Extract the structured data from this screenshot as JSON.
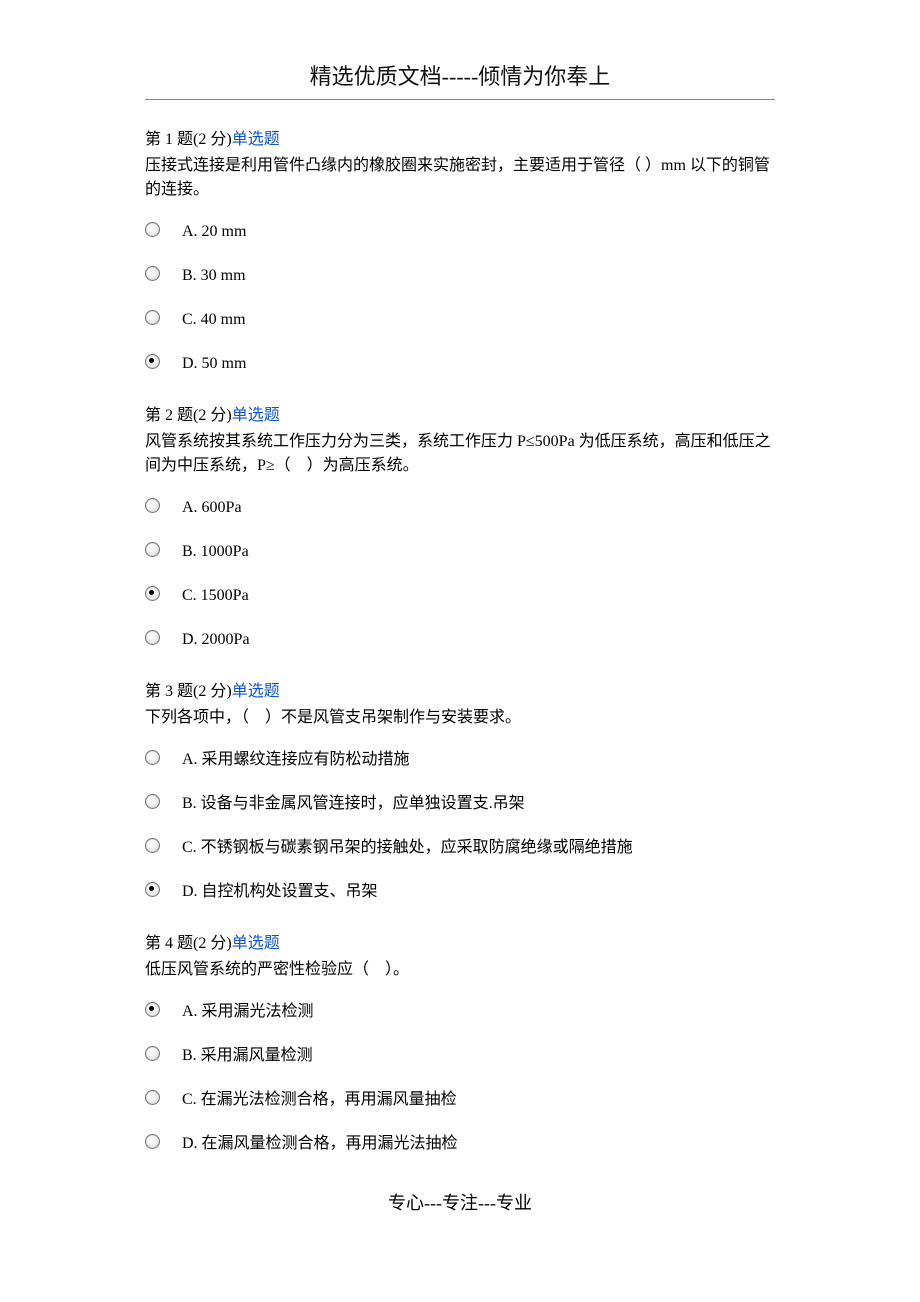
{
  "header": "精选优质文档-----倾情为你奉上",
  "footer": "专心---专注---专业",
  "questions": [
    {
      "number": "第 1 题",
      "points": "(2 分)",
      "type": "单选题",
      "body": "压接式连接是利用管件凸缘内的橡胶圈来实施密封，主要适用于管径（ ）mm 以下的铜管的连接。",
      "options": [
        {
          "label": "A. 20 mm",
          "selected": false
        },
        {
          "label": "B. 30 mm",
          "selected": false
        },
        {
          "label": "C. 40 mm",
          "selected": false
        },
        {
          "label": "D. 50 mm",
          "selected": true
        }
      ]
    },
    {
      "number": "第 2 题",
      "points": "(2 分)",
      "type": "单选题",
      "body": "风管系统按其系统工作压力分为三类，系统工作压力 P≤500Pa 为低压系统，高压和低压之间为中压系统，P≥（　）为高压系统。",
      "options": [
        {
          "label": "A. 600Pa",
          "selected": false
        },
        {
          "label": "B. 1000Pa",
          "selected": false
        },
        {
          "label": "C. 1500Pa",
          "selected": true
        },
        {
          "label": "D. 2000Pa",
          "selected": false
        }
      ]
    },
    {
      "number": "第 3 题",
      "points": "(2 分)",
      "type": "单选题",
      "body": "下列各项中，（　）不是风管支吊架制作与安装要求。",
      "options": [
        {
          "label": "A. 采用螺纹连接应有防松动措施",
          "selected": false
        },
        {
          "label": "B. 设备与非金属风管连接时，应单独设置支.吊架",
          "selected": false
        },
        {
          "label": "C. 不锈钢板与碳素钢吊架的接触处，应采取防腐绝缘或隔绝措施",
          "selected": false
        },
        {
          "label": "D. 自控机构处设置支、吊架",
          "selected": true
        }
      ]
    },
    {
      "number": "第 4 题",
      "points": "(2 分)",
      "type": "单选题",
      "body": "低压风管系统的严密性检验应（　）。",
      "options": [
        {
          "label": "A. 采用漏光法检测",
          "selected": true
        },
        {
          "label": "B. 采用漏风量检测",
          "selected": false
        },
        {
          "label": "C. 在漏光法检测合格，再用漏风量抽检",
          "selected": false
        },
        {
          "label": "D. 在漏风量检测合格，再用漏光法抽检",
          "selected": false
        }
      ]
    }
  ]
}
